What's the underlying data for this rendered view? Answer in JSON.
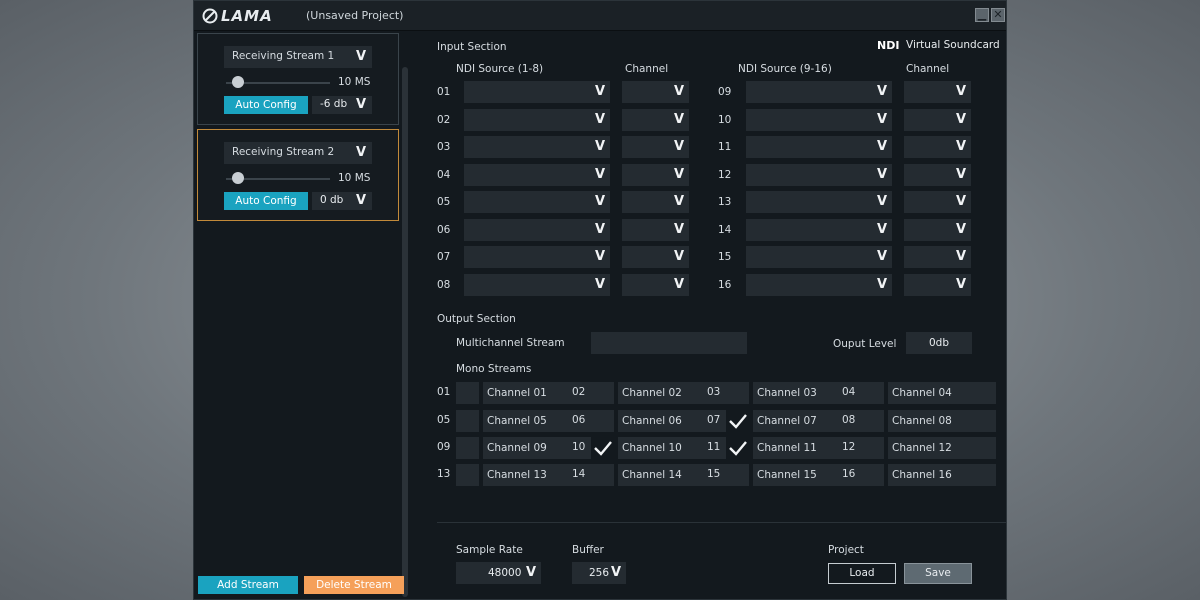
{
  "app": {
    "logo_text": "LAMA",
    "title": "(Unsaved Project)",
    "minimize_icon": "minimize-icon",
    "close_icon": "close-icon"
  },
  "streams": [
    {
      "name": "Receiving Stream 1",
      "latency_value": "10 MS",
      "latency_level": 0.12,
      "auto_config_label": "Auto Config",
      "gain": "-6 db",
      "active": false
    },
    {
      "name": "Receiving Stream 2",
      "latency_value": "10 MS",
      "latency_level": 0.12,
      "auto_config_label": "Auto Config",
      "gain": "0 db",
      "active": true
    }
  ],
  "left_buttons": {
    "add": "Add Stream",
    "delete": "Delete Stream"
  },
  "input": {
    "title": "Input Section",
    "ndi_brand": "NDI",
    "brand_suffix": "Virtual Soundcard",
    "col_source_a": "NDI Source (1-8)",
    "col_channel_a": "Channel",
    "col_source_b": "NDI Source (9-16)",
    "col_channel_b": "Channel",
    "rows_a": [
      "01",
      "02",
      "03",
      "04",
      "05",
      "06",
      "07",
      "08"
    ],
    "rows_b": [
      "09",
      "10",
      "11",
      "12",
      "13",
      "14",
      "15",
      "16"
    ]
  },
  "output": {
    "title": "Output Section",
    "multichannel_label": "Multichannel  Stream",
    "multichannel_value": "",
    "level_label": "Ouput Level",
    "level_value": "0db",
    "mono_label": "Mono Streams",
    "mono": [
      {
        "num": "01",
        "label": "Channel 01",
        "checked": false
      },
      {
        "num": "02",
        "label": "Channel 02",
        "checked": false
      },
      {
        "num": "03",
        "label": "Channel 03",
        "checked": false
      },
      {
        "num": "04",
        "label": "Channel 04",
        "checked": false
      },
      {
        "num": "05",
        "label": "Channel 05",
        "checked": false
      },
      {
        "num": "06",
        "label": "Channel 06",
        "checked": false
      },
      {
        "num": "07",
        "label": "Channel 07",
        "checked": true
      },
      {
        "num": "08",
        "label": "Channel 08",
        "checked": false
      },
      {
        "num": "09",
        "label": "Channel 09",
        "checked": false
      },
      {
        "num": "10",
        "label": "Channel 10",
        "checked": true
      },
      {
        "num": "11",
        "label": "Channel 11",
        "checked": true
      },
      {
        "num": "12",
        "label": "Channel 12",
        "checked": false
      },
      {
        "num": "13",
        "label": "Channel 13",
        "checked": false
      },
      {
        "num": "14",
        "label": "Channel 14",
        "checked": false
      },
      {
        "num": "15",
        "label": "Channel 15",
        "checked": false
      },
      {
        "num": "16",
        "label": "Channel 16",
        "checked": false
      }
    ]
  },
  "footer": {
    "sample_rate_label": "Sample Rate",
    "sample_rate_value": "48000",
    "buffer_label": "Buffer",
    "buffer_value": "256",
    "project_label": "Project",
    "load_label": "Load",
    "save_label": "Save"
  },
  "colors": {
    "accent": "#1aa3c0",
    "danger": "#f5a05a",
    "active_border": "#c28a3a"
  }
}
